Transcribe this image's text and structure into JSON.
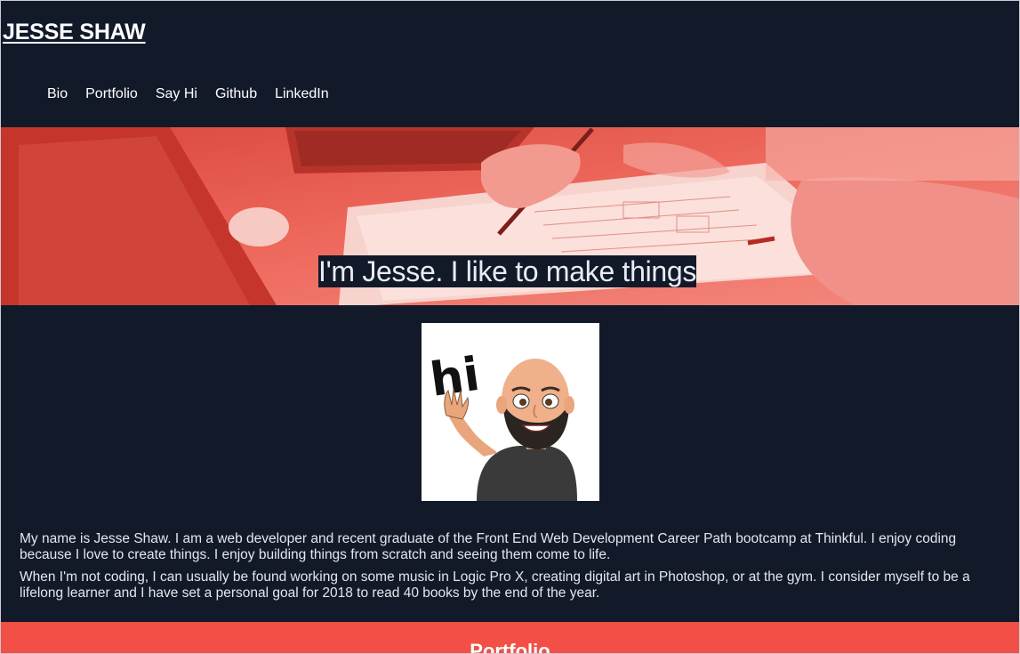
{
  "header": {
    "title": "JESSE SHAW",
    "nav": [
      {
        "label": "Bio"
      },
      {
        "label": "Portfolio"
      },
      {
        "label": "Say Hi"
      },
      {
        "label": "Github"
      },
      {
        "label": "LinkedIn"
      }
    ]
  },
  "hero": {
    "tagline": "I'm Jesse. I like to make things"
  },
  "bio": {
    "avatar_text": "hi",
    "paragraphs": [
      "My name is Jesse Shaw. I am a web developer and recent graduate of the Front End Web Development Career Path bootcamp at Thinkful. I enjoy coding because I love to create things. I enjoy building things from scratch and seeing them come to life.",
      "When I'm not coding, I can usually be found working on some music in Logic Pro X, creating digital art in Photoshop, or at the gym. I consider myself to be a lifelong learner and I have set a personal goal for 2018 to read 40 books by the end of the year."
    ]
  },
  "portfolio": {
    "heading": "Portfolio"
  },
  "colors": {
    "background": "#121a2a",
    "accent": "#f25046",
    "hero_tint": "#e8564a"
  }
}
